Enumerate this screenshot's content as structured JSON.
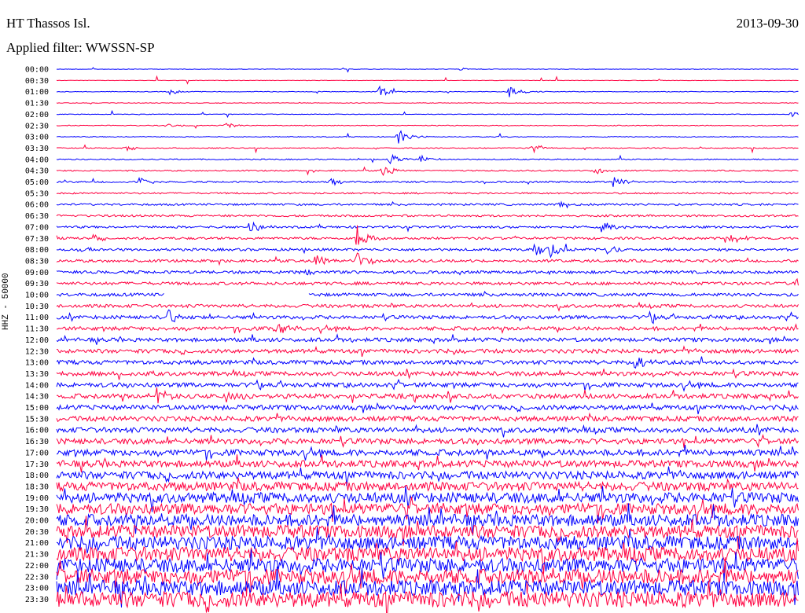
{
  "header": {
    "station": "HT Thassos Isl.",
    "date": "2013-09-30",
    "filter": "Applied filter: WWSSN-SP"
  },
  "chart_data": {
    "type": "line",
    "title": "HT Thassos Isl.",
    "date": "2013-09-30",
    "filter": "WWSSN-SP",
    "ylabel": "HHZ - 50000",
    "row_labels": [
      "00:00",
      "00:30",
      "01:00",
      "01:30",
      "02:00",
      "02:30",
      "03:00",
      "03:30",
      "04:00",
      "04:30",
      "05:00",
      "05:30",
      "06:00",
      "06:30",
      "07:00",
      "07:30",
      "08:00",
      "08:30",
      "09:00",
      "09:30",
      "10:00",
      "10:30",
      "11:00",
      "11:30",
      "12:00",
      "12:30",
      "13:00",
      "13:30",
      "14:00",
      "14:30",
      "15:00",
      "15:30",
      "16:00",
      "16:30",
      "17:00",
      "17:30",
      "18:00",
      "18:30",
      "19:00",
      "19:30",
      "20:00",
      "20:30",
      "21:00",
      "21:30",
      "22:00",
      "22:30",
      "23:00",
      "23:30"
    ],
    "colors": [
      "#0000ff",
      "#ff0040"
    ],
    "noise_level": [
      0.3,
      0.3,
      0.4,
      0.4,
      0.4,
      0.5,
      0.5,
      0.6,
      0.7,
      0.8,
      1.0,
      1.0,
      1.2,
      1.3,
      1.4,
      1.5,
      1.6,
      1.7,
      1.8,
      1.9,
      2.0,
      2.1,
      2.2,
      2.3,
      2.4,
      2.5,
      2.6,
      2.7,
      2.8,
      2.9,
      3.0,
      3.1,
      3.3,
      3.5,
      3.8,
      4.2,
      4.8,
      5.5,
      6.5,
      7.0,
      7.5,
      8.0,
      8.5,
      9.0,
      9.0,
      9.5,
      9.5,
      10.0
    ],
    "events": [
      {
        "row": 0,
        "t": 0.545,
        "amp": 2
      },
      {
        "row": 2,
        "t": 0.153,
        "amp": 4
      },
      {
        "row": 2,
        "t": 0.435,
        "amp": 8
      },
      {
        "row": 2,
        "t": 0.61,
        "amp": 8
      },
      {
        "row": 4,
        "t": 0.99,
        "amp": 3
      },
      {
        "row": 5,
        "t": 0.148,
        "amp": 3
      },
      {
        "row": 5,
        "t": 0.228,
        "amp": 4
      },
      {
        "row": 6,
        "t": 0.46,
        "amp": 10
      },
      {
        "row": 7,
        "t": 0.094,
        "amp": 4
      },
      {
        "row": 7,
        "t": 0.64,
        "amp": 8
      },
      {
        "row": 8,
        "t": 0.45,
        "amp": 8
      },
      {
        "row": 8,
        "t": 0.49,
        "amp": 6
      },
      {
        "row": 9,
        "t": 0.44,
        "amp": 10
      },
      {
        "row": 9,
        "t": 0.725,
        "amp": 8
      },
      {
        "row": 10,
        "t": 0.11,
        "amp": 6
      },
      {
        "row": 10,
        "t": 0.37,
        "amp": 5
      },
      {
        "row": 10,
        "t": 0.75,
        "amp": 8
      },
      {
        "row": 12,
        "t": 0.68,
        "amp": 6
      },
      {
        "row": 14,
        "t": 0.26,
        "amp": 12
      },
      {
        "row": 14,
        "t": 0.735,
        "amp": 8
      },
      {
        "row": 15,
        "t": 0.05,
        "amp": 6
      },
      {
        "row": 15,
        "t": 0.405,
        "amp": 18
      },
      {
        "row": 15,
        "t": 0.91,
        "amp": 6
      },
      {
        "row": 16,
        "t": 0.03,
        "amp": 5
      },
      {
        "row": 16,
        "t": 0.645,
        "amp": 10
      },
      {
        "row": 16,
        "t": 0.665,
        "amp": 14
      },
      {
        "row": 16,
        "t": 0.74,
        "amp": 10
      },
      {
        "row": 17,
        "t": 0.35,
        "amp": 12
      },
      {
        "row": 17,
        "t": 0.405,
        "amp": 14
      },
      {
        "row": 18,
        "t": 0.33,
        "amp": 8
      },
      {
        "row": 19,
        "t": 0.995,
        "amp": 10
      },
      {
        "row": 22,
        "t": 0.15,
        "amp": 10
      },
      {
        "row": 22,
        "t": 0.8,
        "amp": 12
      },
      {
        "row": 23,
        "t": 0.295,
        "amp": 10
      },
      {
        "row": 26,
        "t": 0.78,
        "amp": 8
      },
      {
        "row": 28,
        "t": 0.27,
        "amp": 8
      },
      {
        "row": 29,
        "t": 0.135,
        "amp": 10
      },
      {
        "row": 29,
        "t": 0.23,
        "amp": 10
      }
    ],
    "gaps": [
      {
        "row": 20,
        "t0": 0.145,
        "t1": 0.34
      }
    ]
  }
}
